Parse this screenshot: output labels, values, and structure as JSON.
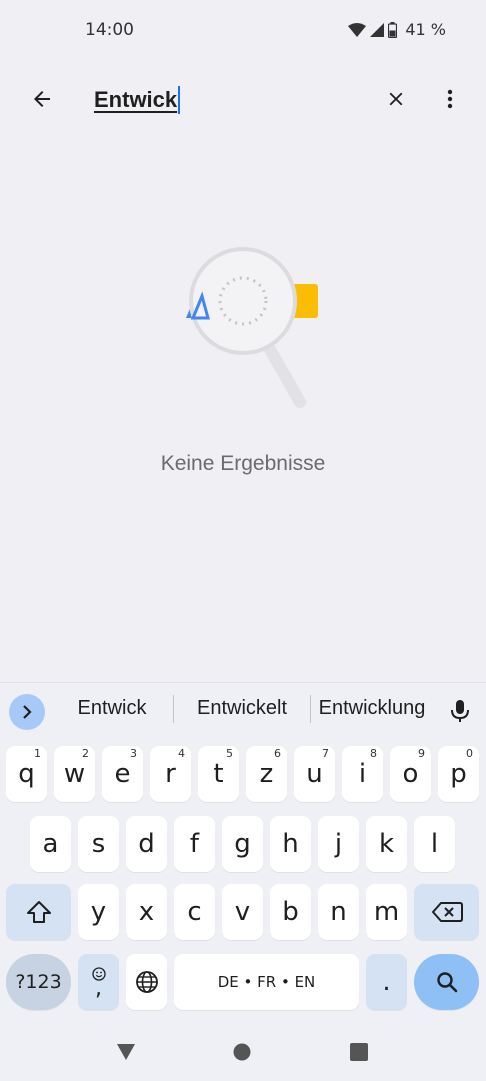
{
  "status_bar": {
    "time": "14:00",
    "battery_percent": "41 %"
  },
  "search": {
    "query": "Entwick"
  },
  "empty_state": {
    "message": "Keine Ergebnisse"
  },
  "keyboard": {
    "suggestions": [
      "Entwick",
      "Entwickelt",
      "Entwicklung"
    ],
    "row1": [
      {
        "key": "q",
        "hint": "1"
      },
      {
        "key": "w",
        "hint": "2"
      },
      {
        "key": "e",
        "hint": "3"
      },
      {
        "key": "r",
        "hint": "4"
      },
      {
        "key": "t",
        "hint": "5"
      },
      {
        "key": "z",
        "hint": "6"
      },
      {
        "key": "u",
        "hint": "7"
      },
      {
        "key": "i",
        "hint": "8"
      },
      {
        "key": "o",
        "hint": "9"
      },
      {
        "key": "p",
        "hint": "0"
      }
    ],
    "row2": [
      "a",
      "s",
      "d",
      "f",
      "g",
      "h",
      "j",
      "k",
      "l"
    ],
    "row3": [
      "y",
      "x",
      "c",
      "v",
      "b",
      "n",
      "m"
    ],
    "symbols_label": "?123",
    "emoji_sub": ",",
    "space_label": "DE • FR • EN",
    "period_label": "."
  },
  "icons": {
    "back": "arrow-left-icon",
    "clear": "close-icon",
    "more": "more-vert-icon",
    "mic": "mic-icon",
    "search_key": "search-icon"
  },
  "colors": {
    "accent": "#1a73e8",
    "search_key": "#8fc0f5",
    "special_key": "#d4e2f4",
    "background": "#f0eff4"
  }
}
